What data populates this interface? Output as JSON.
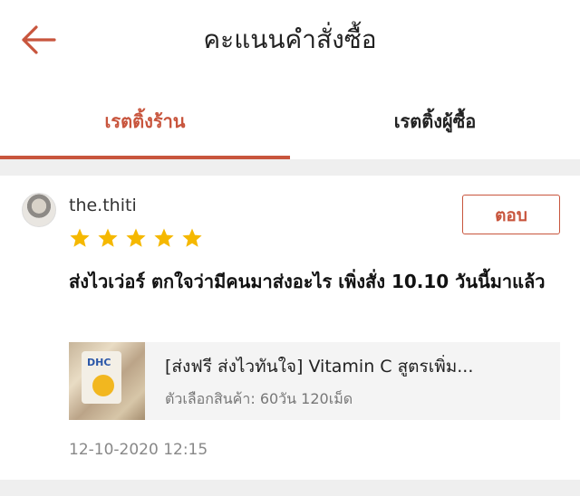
{
  "header": {
    "title": "คะแนนคำสั่งซื้อ"
  },
  "tabs": [
    {
      "label": "เรตติ้งร้าน"
    },
    {
      "label": "เรตติ้งผู้ซื้อ"
    }
  ],
  "review": {
    "username": "the.thiti",
    "rating": 5,
    "reply_label": "ตอบ",
    "comment": "ส่งไวเว่อร์ ตกใจว่ามีคนมาส่งอะไร เพิ่งสั่ง 10.10 วันนี้มาแล้ว",
    "product": {
      "name": "[ส่งฟรี ส่งไวทันใจ] Vitamin C สูตรเพิ่ม...",
      "option": "ตัวเลือกสินค้า: 60วัน 120เม็ด",
      "image_text": "DHC"
    },
    "datetime": "12-10-2020 12:15"
  },
  "colors": {
    "accent": "#c8553d",
    "star": "#f5b800",
    "separator": "#efefef"
  }
}
